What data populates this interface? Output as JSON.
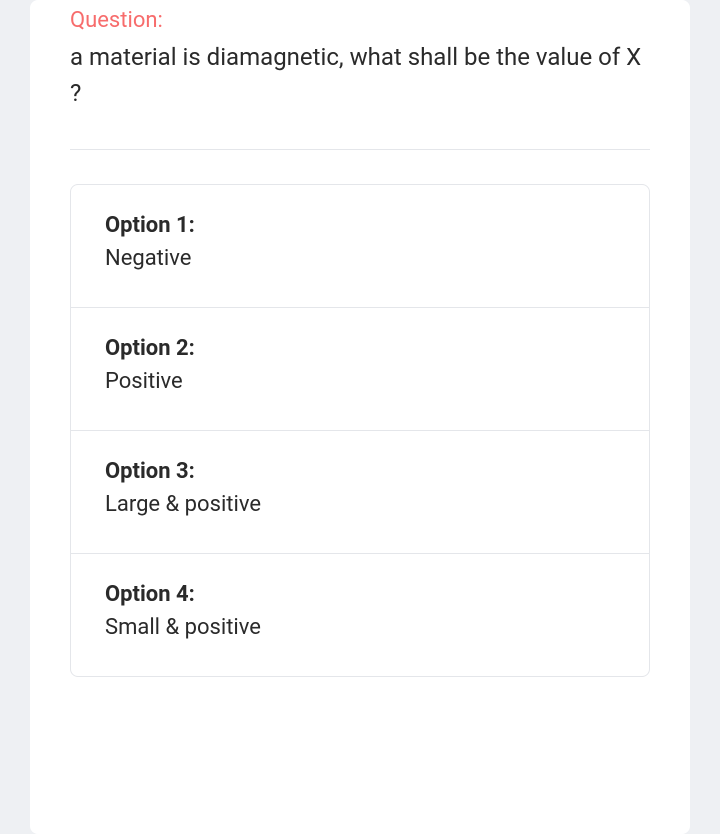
{
  "question": {
    "label": "Question:",
    "text": "a material is diamagnetic, what shall be the value of  X ?"
  },
  "options": [
    {
      "label": "Option 1:",
      "value": "Negative"
    },
    {
      "label": "Option 2:",
      "value": "Positive"
    },
    {
      "label": "Option 3:",
      "value": "Large & positive"
    },
    {
      "label": "Option 4:",
      "value": "Small & positive"
    }
  ]
}
